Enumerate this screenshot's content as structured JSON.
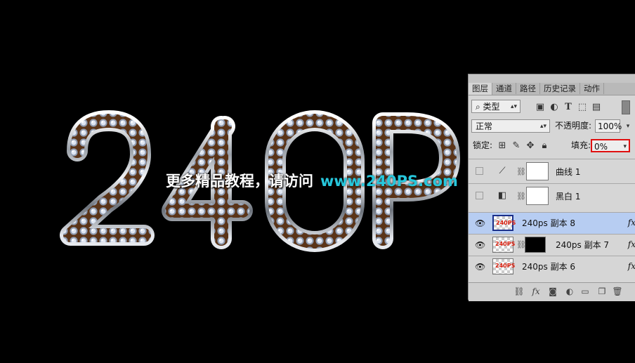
{
  "watermark": {
    "cn": "更多精品教程，请访问",
    "url": "www.240PS.com"
  },
  "artwork": {
    "text": "240P",
    "colors": {
      "chrome": "#c9ced6",
      "gem": "#9aa7bb",
      "copper": "#6a3a1a"
    }
  },
  "panel": {
    "tabs": [
      "图层",
      "通道",
      "路径",
      "历史记录",
      "动作"
    ],
    "filter": {
      "label": "类型",
      "icons": [
        "image-filter-icon",
        "adjust-filter-icon",
        "type-filter-icon",
        "shape-filter-icon",
        "smart-filter-icon"
      ]
    },
    "blend_mode": "正常",
    "opacity_label": "不透明度:",
    "opacity_value": "100%",
    "lock_label": "锁定:",
    "fill_label": "填充:",
    "fill_value": "0%",
    "layers": [
      {
        "name": "曲线 1",
        "type": "adjustment-curves",
        "visible": false,
        "selected": false,
        "fx": false
      },
      {
        "name": "黑白 1",
        "type": "adjustment-bw",
        "visible": false,
        "selected": false,
        "fx": false
      },
      {
        "name": "240ps 副本 8",
        "type": "text-raster",
        "thumb_text": "240PS",
        "visible": true,
        "selected": true,
        "fx": true
      },
      {
        "name": "240ps 副本 7",
        "type": "masked",
        "thumb_text": "240PS",
        "visible": true,
        "selected": false,
        "fx": true
      },
      {
        "name": "240ps 副本 6",
        "type": "text-raster",
        "thumb_text": "240PS",
        "visible": true,
        "selected": false,
        "fx": true
      }
    ],
    "fx_label": "fx"
  }
}
